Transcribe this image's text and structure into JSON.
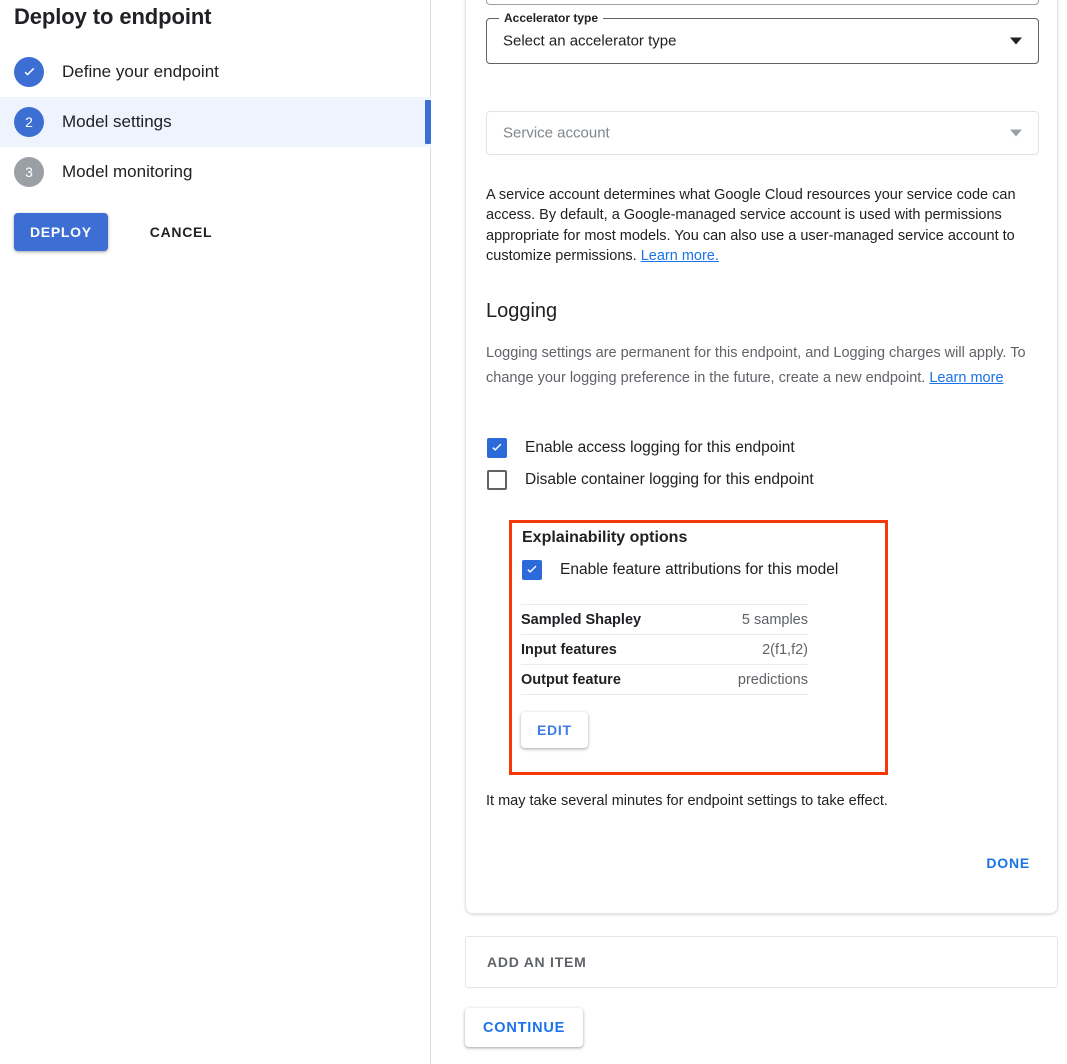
{
  "wizard": {
    "title": "Deploy to endpoint",
    "steps": [
      {
        "number": "1",
        "label": "Define your endpoint",
        "state": "done",
        "marker_icon": "check-icon"
      },
      {
        "number": "2",
        "label": "Model settings",
        "state": "current"
      },
      {
        "number": "3",
        "label": "Model monitoring",
        "state": "pending"
      }
    ],
    "deploy_label": "DEPLOY",
    "cancel_label": "CANCEL"
  },
  "form": {
    "accelerator": {
      "label": "Accelerator type",
      "value": "Select an accelerator type",
      "caret_icon": "chevron-down-icon"
    },
    "service_account": {
      "placeholder": "Service account",
      "caret_icon": "chevron-down-icon"
    },
    "service_account_help": {
      "text": " A service account determines what Google Cloud resources your service code can access. By default, a Google-managed service account is used with permissions appropriate for most models. You can also use a user-managed service account to customize permissions. ",
      "link": "Learn more."
    }
  },
  "logging": {
    "heading": "Logging",
    "description": "Logging settings are permanent for this endpoint, and Logging charges will apply. To change your logging preference in the future, create a new endpoint. ",
    "link": "Learn more",
    "checkboxes": [
      {
        "label": "Enable access logging for this endpoint",
        "checked": true,
        "icon": "checkmark-icon"
      },
      {
        "label": "Disable container logging for this endpoint",
        "checked": false
      }
    ]
  },
  "explainability": {
    "heading": "Explainability options",
    "checkbox": {
      "label": "Enable feature attributions for this model",
      "checked": true,
      "icon": "checkmark-icon"
    },
    "rows": [
      {
        "key": "Sampled Shapley",
        "value": "5 samples"
      },
      {
        "key": "Input features",
        "value": "2(f1,f2)"
      },
      {
        "key": "Output feature",
        "value": "predictions"
      }
    ],
    "edit_label": "EDIT",
    "highlight_color": "#f5380a"
  },
  "footer": {
    "effect_note": "It may take several minutes for endpoint settings to take effect.",
    "done_label": "DONE",
    "add_item_label": "ADD AN ITEM",
    "continue_label": "CONTINUE"
  },
  "colors": {
    "accent_blue": "#1a73e8",
    "button_blue": "#3c6ed4",
    "checkbox_blue": "#2d6ad9",
    "pending_gray": "#9aa0a6",
    "annotation_red": "#f5380a"
  }
}
